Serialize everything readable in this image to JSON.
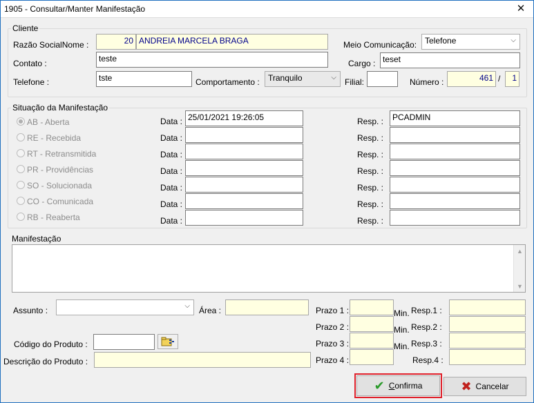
{
  "window": {
    "title": "1905 - Consultar/Manter Manifestação",
    "close_glyph": "✕"
  },
  "cliente": {
    "group_label": "Cliente",
    "razao_label": "Razão SocialNome :",
    "razao_code": "20",
    "razao_name": "ANDREIA MARCELA BRAGA",
    "meio_label": "Meio Comunicação:",
    "meio_value": "Telefone",
    "contato_label": "Contato :",
    "contato_value": "teste",
    "cargo_label": "Cargo :",
    "cargo_value": "teset",
    "telefone_label": "Telefone :",
    "telefone_value": "tste",
    "comportamento_label": "Comportamento :",
    "comportamento_value": "Tranquilo",
    "filial_label": "Filial:",
    "filial_value": "",
    "numero_label": "Número :",
    "numero_value": "461",
    "numero_sep": "/",
    "numero_seq": "1"
  },
  "situacao": {
    "group_label": "Situação da Manifestação",
    "data_label": "Data :",
    "resp_label": "Resp. :",
    "rows": [
      {
        "label": "AB - Aberta",
        "data": "25/01/2021 19:26:05",
        "resp": "PCADMIN"
      },
      {
        "label": "RE - Recebida",
        "data": "",
        "resp": ""
      },
      {
        "label": "RT - Retransmitida",
        "data": "",
        "resp": ""
      },
      {
        "label": "PR - Providências",
        "data": "",
        "resp": ""
      },
      {
        "label": "SO - Solucionada",
        "data": "",
        "resp": ""
      },
      {
        "label": "CO - Comunicada",
        "data": "",
        "resp": ""
      },
      {
        "label": "RB - Reaberta",
        "data": "",
        "resp": ""
      }
    ]
  },
  "manifestacao": {
    "label": "Manifestação",
    "value": ""
  },
  "bottom": {
    "assunto_label": "Assunto :",
    "assunto_value": "",
    "area_label": "Área :",
    "area_value": "",
    "codigo_label": "Código do Produto :",
    "codigo_value": "",
    "descricao_label": "Descrição do Produto :",
    "descricao_value": "",
    "prazos": [
      {
        "label": "Prazo 1 :",
        "unit": "Min.",
        "resp_label": "Resp.1 :"
      },
      {
        "label": "Prazo 2 :",
        "unit": "Min.",
        "resp_label": "Resp.2 :"
      },
      {
        "label": "Prazo 3 :",
        "unit": "Min.",
        "resp_label": "Resp.3 :"
      },
      {
        "label": "Prazo 4 :",
        "unit": "",
        "resp_label": "Resp.4 :"
      }
    ]
  },
  "buttons": {
    "confirma_first": "C",
    "confirma_rest": "onfirma",
    "cancelar_label": "Cancelar"
  },
  "icons": {
    "close": "close-icon",
    "dropdown": "chevron-down-icon",
    "browse": "folder-search-icon",
    "confirm": "checkmark-icon",
    "cancel": "x-icon"
  },
  "colors": {
    "readonly_bg": "#ffffe1",
    "value_blue": "#00008b",
    "highlight_red": "#e0202a",
    "confirm_green": "#2a9a2a",
    "cancel_red": "#c0211d"
  }
}
